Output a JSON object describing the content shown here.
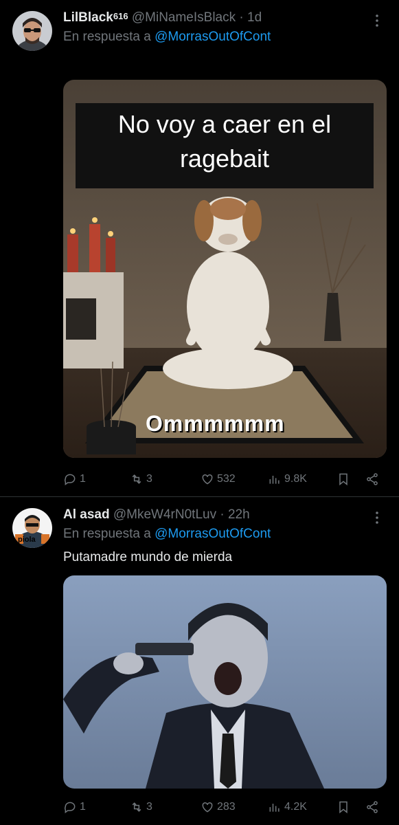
{
  "tweets": [
    {
      "display_name": "LilBlack",
      "name_sup": "616",
      "handle": "@MiNameIsBlack",
      "time": "1d",
      "reply_prefix": "En respuesta a",
      "reply_to": "@MorrasOutOfCont",
      "text": "",
      "image": {
        "caption_top_line1": "No voy a caer en el",
        "caption_top_line2": "ragebait",
        "caption_bottom": "Ommmmmm"
      },
      "actions": {
        "replies": "1",
        "retweets": "3",
        "likes": "532",
        "views": "9.8K"
      }
    },
    {
      "display_name": "Al asad",
      "name_sup": "",
      "handle": "@MkeW4rN0tLuv",
      "time": "22h",
      "reply_prefix": "En respuesta a",
      "reply_to": "@MorrasOutOfCont",
      "text": "Putamadre mundo de mierda",
      "avatar_label": "piola",
      "actions": {
        "replies": "1",
        "retweets": "3",
        "likes": "283",
        "views": "4.2K"
      }
    }
  ],
  "colors": {
    "background": "#000000",
    "text": "#e7e9ea",
    "muted": "#71767b",
    "link": "#1d9bf0",
    "divider": "#2f3336"
  }
}
